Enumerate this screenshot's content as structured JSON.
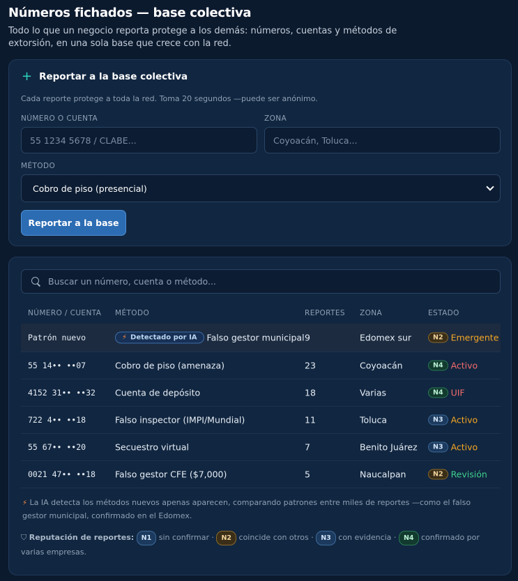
{
  "header": {
    "title": "Números fichados — base colectiva",
    "subtitle": "Todo lo que un negocio reporta protege a los demás: números, cuentas y métodos de extorsión, en una sola base que crece con la red."
  },
  "report_form": {
    "heading": "Reportar a la base colectiva",
    "description": "Cada reporte protege a toda la red. Toma 20 segundos —puede ser anónimo.",
    "number_label": "NÚMERO O CUENTA",
    "number_placeholder": "55 1234 5678 / CLABE...",
    "zone_label": "ZONA",
    "zone_placeholder": "Coyoacán, Toluca...",
    "method_label": "MÉTODO",
    "method_selected": "Cobro de piso (presencial)",
    "submit_label": "Reportar a la base"
  },
  "database": {
    "search_placeholder": "Buscar un número, cuenta o método...",
    "columns": [
      "NÚMERO / CUENTA",
      "MÉTODO",
      "REPORTES",
      "ZONA",
      "ESTADO"
    ],
    "rows": [
      {
        "number": "Patrón nuevo",
        "ai_badge": "Detectado por IA",
        "method": "Falso gestor municipal",
        "reports": "9",
        "zone": "Edomex sur",
        "level": "N2",
        "status": "Emergente",
        "status_color": "#f5a623"
      },
      {
        "number": "55 14•• ••07",
        "ai_badge": "",
        "method": "Cobro de piso (amenaza)",
        "reports": "23",
        "zone": "Coyoacán",
        "level": "N4",
        "status": "Activo",
        "status_color": "#f26b6b"
      },
      {
        "number": "4152 31•• ••32",
        "ai_badge": "",
        "method": "Cuenta de depósito",
        "reports": "18",
        "zone": "Varias",
        "level": "N4",
        "status": "UIF",
        "status_color": "#f26b6b"
      },
      {
        "number": "722 4•• ••18",
        "ai_badge": "",
        "method": "Falso inspector (IMPI/Mundial)",
        "reports": "11",
        "zone": "Toluca",
        "level": "N3",
        "status": "Activo",
        "status_color": "#f5a623"
      },
      {
        "number": "55 67•• ••20",
        "ai_badge": "",
        "method": "Secuestro virtual",
        "reports": "7",
        "zone": "Benito Juárez",
        "level": "N3",
        "status": "Activo",
        "status_color": "#f5a623"
      },
      {
        "number": "0021 47•• ••18",
        "ai_badge": "",
        "method": "Falso gestor CFE ($7,000)",
        "reports": "5",
        "zone": "Naucalpan",
        "level": "N2",
        "status": "Revisión",
        "status_color": "#3fcf8e"
      }
    ],
    "ai_note": "La IA detecta los métodos nuevos apenas aparecen, comparando patrones entre miles de reportes —como el falso gestor municipal, confirmado en el Edomex.",
    "reputation": {
      "label": "Reputación de reportes:",
      "levels": [
        {
          "code": "N1",
          "text": "sin confirmar"
        },
        {
          "code": "N2",
          "text": "coincide con otros"
        },
        {
          "code": "N3",
          "text": "con evidencia"
        },
        {
          "code": "N4",
          "text": "confirmado por varias empresas."
        }
      ]
    }
  }
}
